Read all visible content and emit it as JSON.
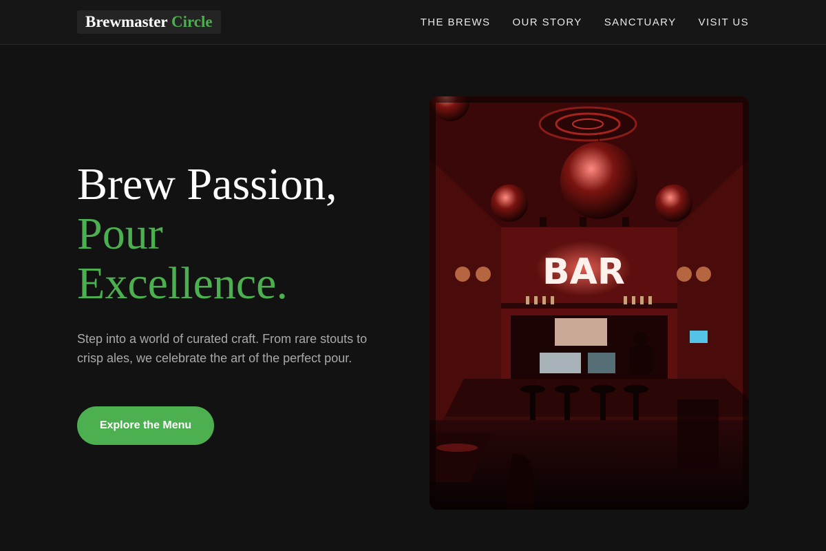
{
  "brand": {
    "name_primary": "Brewmaster",
    "name_accent": "Circle"
  },
  "nav": {
    "items": [
      {
        "label": "THE BREWS"
      },
      {
        "label": "OUR STORY"
      },
      {
        "label": "SANCTUARY"
      },
      {
        "label": "VISIT US"
      }
    ]
  },
  "hero": {
    "headline_line1": "Brew Passion,",
    "headline_line2": "Pour",
    "headline_line3": "Excellence.",
    "lead": "Step into a world of curated craft. From rare stouts to crisp ales, we celebrate the art of the perfect pour.",
    "cta_label": "Explore the Menu",
    "image_sign_text": "BAR"
  },
  "colors": {
    "accent": "#4caf50",
    "background": "#121212",
    "header": "#161616"
  }
}
